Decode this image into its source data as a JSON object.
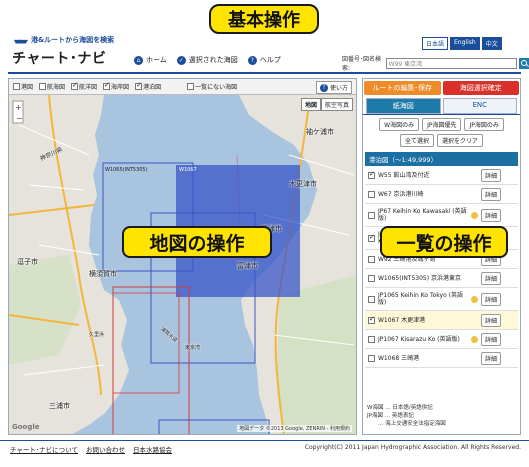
{
  "annotations": {
    "basic": "基本操作",
    "map": "地図の操作",
    "list": "一覧の操作"
  },
  "header": {
    "tagline": "港&ルートから海図を検索",
    "title": "チャート･ナビ",
    "nav": [
      {
        "label": "ホーム",
        "icon": "home-icon"
      },
      {
        "label": "選択された海図",
        "icon": "check-icon"
      },
      {
        "label": "ヘルプ",
        "icon": "help-icon"
      }
    ],
    "languages": [
      {
        "label": "日本語",
        "active": false
      },
      {
        "label": "English",
        "active": true
      },
      {
        "label": "中文",
        "active": true
      }
    ],
    "search": {
      "label": "図番号･図名検索:",
      "value": "W99 東京湾"
    }
  },
  "map": {
    "layers": [
      {
        "label": "港図",
        "checked": false
      },
      {
        "label": "航海図",
        "checked": false
      },
      {
        "label": "航洋図",
        "checked": true
      },
      {
        "label": "海岸図",
        "checked": true
      },
      {
        "label": "港泊図",
        "checked": true
      },
      {
        "label": "一覧にない海図",
        "checked": false
      }
    ],
    "usage_label": "使い方",
    "map_types": [
      "地図",
      "航空写真"
    ],
    "active_map_type": "地図",
    "places": {
      "sodegaura": "袖ケ浦市",
      "kisarazu": "木更津市",
      "kimitsu": "君津市",
      "futtsu": "富津市",
      "zushi": "逗子市",
      "yokosuka": "横須賀市",
      "miura": "三浦市",
      "kanagawa": "神奈川県",
      "bay": "東京湾",
      "uraga": "浦賀水道",
      "kurihama": "久里浜"
    },
    "chart_labels": [
      "W1065(INT5305)",
      "W1067"
    ],
    "google_mark": "Google",
    "attribution": "地図データ ©2013 Google, ZENRIN - 利用規約"
  },
  "panel": {
    "edit_save": "ルートの編集･保存",
    "confirm": "海図選択確定",
    "tabs": [
      "紙海図",
      "ENC"
    ],
    "active_tab": "紙海図",
    "filters": [
      "W海図のみ",
      "JP海図優先",
      "JP海図のみ",
      "全て選択",
      "選択をクリア"
    ],
    "group_title": "港泊図（～1:49,999）",
    "detail_label": "詳細",
    "charts": [
      {
        "name": "W55 館山湾及付近",
        "checked": true,
        "star": false,
        "tall": false,
        "hl": false
      },
      {
        "name": "W67 京浜港川崎",
        "checked": false,
        "star": false,
        "tall": false,
        "hl": false
      },
      {
        "name": "JP67 Keihin Ko Kawasaki (英語版)",
        "checked": false,
        "star": true,
        "tall": true,
        "hl": false
      },
      {
        "name": "JP90 Tokyo Wan Kanagawa Kunihama (英語版)",
        "checked": true,
        "star": true,
        "tall": true,
        "hl": false
      },
      {
        "name": "W92 三崎港及城ヶ島",
        "checked": false,
        "star": false,
        "tall": false,
        "hl": false
      },
      {
        "name": "W1065(INT5305) 京浜港東京",
        "checked": false,
        "star": false,
        "tall": false,
        "hl": false
      },
      {
        "name": "JP1065 Keihin Ko Tokyo (英語版)",
        "checked": false,
        "star": true,
        "tall": true,
        "hl": false
      },
      {
        "name": "W1067 木更津港",
        "checked": true,
        "star": false,
        "tall": false,
        "hl": true
      },
      {
        "name": "JP1067 Kisarazu Ko (英語版)",
        "checked": false,
        "star": true,
        "tall": false,
        "hl": false
      },
      {
        "name": "W1068 三崎港",
        "checked": false,
        "star": false,
        "tall": false,
        "hl": false
      }
    ],
    "legend": [
      "W海図 … 日本語/英語併記",
      "JP海図 … 英語表記",
      "　　… 海上交通安全法指定海図"
    ]
  },
  "footer": {
    "links": [
      "チャート･ナビについて",
      "お問い合わせ",
      "日本水路協会"
    ],
    "copyright": "Copyright(C) 2011 Japan Hydrographic Association. All Rights Reserved."
  }
}
